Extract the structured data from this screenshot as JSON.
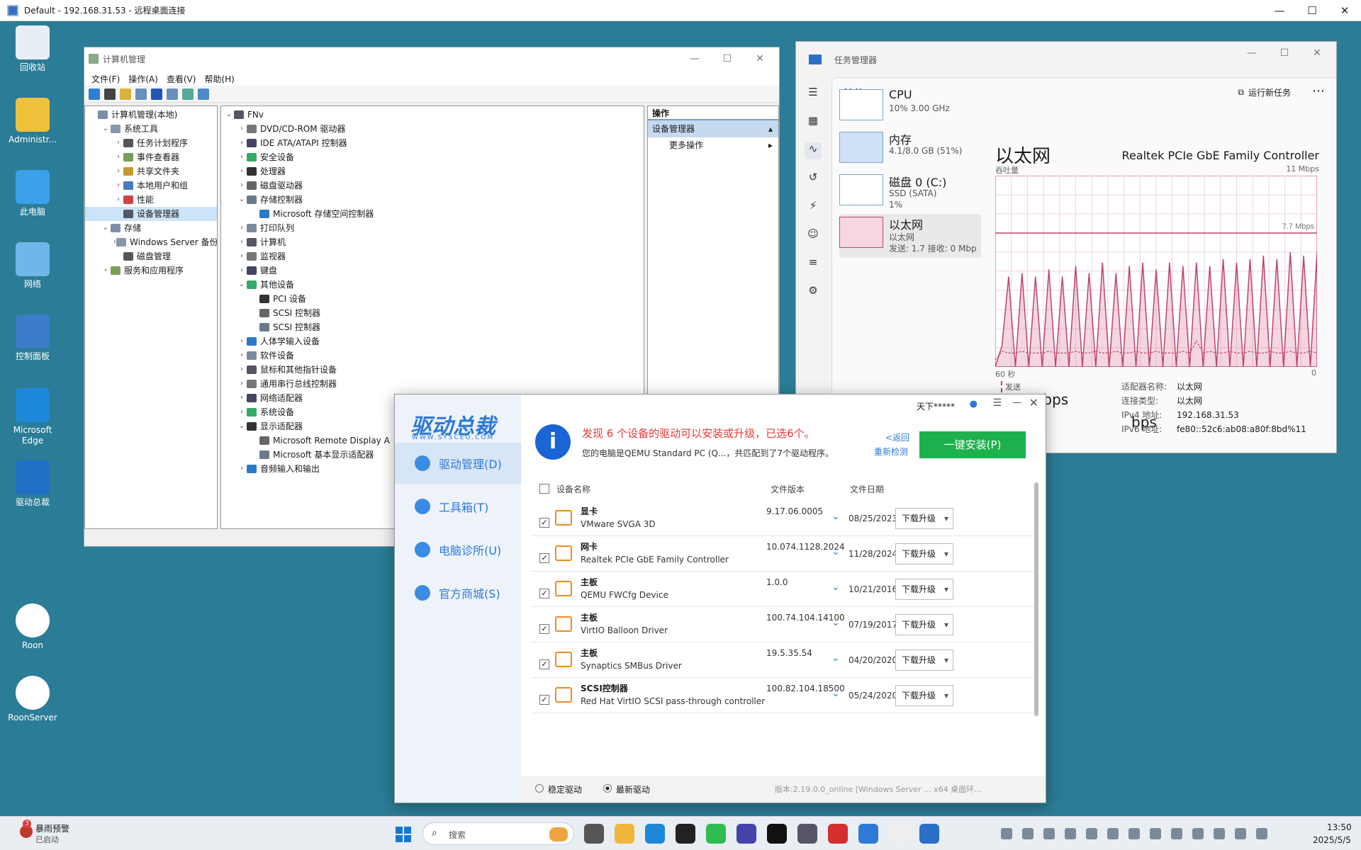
{
  "rdp": {
    "title": "Default - 192.168.31.53 - 远程桌面连接"
  },
  "desktop": {
    "icons": [
      {
        "label": "回收站",
        "icon": "recycle-bin-icon"
      },
      {
        "label": "Administr...",
        "icon": "folder-icon"
      },
      {
        "label": "此电脑",
        "icon": "monitor-icon"
      },
      {
        "label": "网络",
        "icon": "network-icon"
      },
      {
        "label": "控制面板",
        "icon": "control-panel-icon"
      },
      {
        "label": "Microsoft Edge",
        "icon": "edge-icon"
      },
      {
        "label": "驱动总裁",
        "icon": "driver-app-icon"
      },
      {
        "label": "Roon",
        "icon": "roon-icon"
      },
      {
        "label": "RoonServer",
        "icon": "roon-server-icon"
      }
    ]
  },
  "cm": {
    "title": "计算机管理",
    "menu": [
      "文件(F)",
      "操作(A)",
      "查看(V)",
      "帮助(H)"
    ],
    "tree": [
      {
        "label": "计算机管理(本地)",
        "indent": 0,
        "exp": ""
      },
      {
        "label": "系统工具",
        "indent": 1,
        "exp": "⌄"
      },
      {
        "label": "任务计划程序",
        "indent": 2,
        "exp": "›"
      },
      {
        "label": "事件查看器",
        "indent": 2,
        "exp": "›"
      },
      {
        "label": "共享文件夹",
        "indent": 2,
        "exp": "›"
      },
      {
        "label": "本地用户和组",
        "indent": 2,
        "exp": "›"
      },
      {
        "label": "性能",
        "indent": 2,
        "exp": "›"
      },
      {
        "label": "设备管理器",
        "indent": 2,
        "exp": "",
        "sel": true
      },
      {
        "label": "存储",
        "indent": 1,
        "exp": "⌄"
      },
      {
        "label": "Windows Server 备份",
        "indent": 2,
        "exp": "›"
      },
      {
        "label": "磁盘管理",
        "indent": 2,
        "exp": ""
      },
      {
        "label": "服务和应用程序",
        "indent": 1,
        "exp": "›"
      }
    ],
    "devices": [
      {
        "label": "FNv",
        "indent": 0,
        "exp": "⌄"
      },
      {
        "label": "DVD/CD-ROM 驱动器",
        "indent": 1,
        "exp": "›"
      },
      {
        "label": "IDE ATA/ATAPI 控制器",
        "indent": 1,
        "exp": "›"
      },
      {
        "label": "安全设备",
        "indent": 1,
        "exp": "›"
      },
      {
        "label": "处理器",
        "indent": 1,
        "exp": "›"
      },
      {
        "label": "磁盘驱动器",
        "indent": 1,
        "exp": "›"
      },
      {
        "label": "存储控制器",
        "indent": 1,
        "exp": "⌄"
      },
      {
        "label": "Microsoft 存储空间控制器",
        "indent": 2,
        "exp": ""
      },
      {
        "label": "打印队列",
        "indent": 1,
        "exp": "›"
      },
      {
        "label": "计算机",
        "indent": 1,
        "exp": "›"
      },
      {
        "label": "监视器",
        "indent": 1,
        "exp": "›"
      },
      {
        "label": "键盘",
        "indent": 1,
        "exp": "›"
      },
      {
        "label": "其他设备",
        "indent": 1,
        "exp": "⌄"
      },
      {
        "label": "PCI 设备",
        "indent": 2,
        "exp": ""
      },
      {
        "label": "SCSI 控制器",
        "indent": 2,
        "exp": ""
      },
      {
        "label": "SCSI 控制器",
        "indent": 2,
        "exp": ""
      },
      {
        "label": "人体学输入设备",
        "indent": 1,
        "exp": "›"
      },
      {
        "label": "软件设备",
        "indent": 1,
        "exp": "›"
      },
      {
        "label": "鼠标和其他指针设备",
        "indent": 1,
        "exp": "›"
      },
      {
        "label": "通用串行总线控制器",
        "indent": 1,
        "exp": "›"
      },
      {
        "label": "网络适配器",
        "indent": 1,
        "exp": "›"
      },
      {
        "label": "系统设备",
        "indent": 1,
        "exp": "›"
      },
      {
        "label": "显示适配器",
        "indent": 1,
        "exp": "⌄"
      },
      {
        "label": "Microsoft Remote Display A",
        "indent": 2,
        "exp": ""
      },
      {
        "label": "Microsoft 基本显示适配器",
        "indent": 2,
        "exp": ""
      },
      {
        "label": "音频输入和输出",
        "indent": 1,
        "exp": "›"
      }
    ],
    "actions": {
      "header": "操作",
      "section": "设备管理器",
      "more": "更多操作"
    }
  },
  "tm": {
    "title": "任务管理器",
    "page": "性能",
    "run_new": "运行新任务",
    "items": [
      {
        "name": "CPU",
        "s1": "10% 3.00 GHz",
        "s2": ""
      },
      {
        "name": "内存",
        "s1": "4.1/8.0 GB (51%)",
        "s2": ""
      },
      {
        "name": "磁盘 0 (C:)",
        "s1": "SSD (SATA)",
        "s2": "1%"
      },
      {
        "name": "以太网",
        "s1": "以太网",
        "s2": "发送: 1.7  接收: 0 Mbp"
      }
    ],
    "detail": {
      "title": "以太网",
      "adapter": "Realtek PCIe GbE Family Controller",
      "throughput": "吞吐量",
      "max": "11 Mbps",
      "line": "7.7 Mbps",
      "xleft": "60 秒",
      "xright": "0",
      "send_label": "发送",
      "send_value": "1.7 Mbps",
      "recv_value": "bps",
      "info": [
        {
          "k": "适配器名称:",
          "v": "以太网"
        },
        {
          "k": "连接类型:",
          "v": "以太网"
        },
        {
          "k": "IPv4 地址:",
          "v": "192.168.31.53"
        },
        {
          "k": "IPv6 地址:",
          "v": "fe80::52c6:ab08:a80f:8bd%11"
        }
      ]
    }
  },
  "dr": {
    "brand": "驱动总裁",
    "brand_sub": "WWW.SYSCEO.COM",
    "user": "天下*****",
    "nav": [
      "驱动管理(D)",
      "工具箱(T)",
      "电脑诊所(U)",
      "官方商城(S)"
    ],
    "alert": "发现 6 个设备的驱动可以安装或升级，已选6个。",
    "sub": "您的电脑是QEMU Standard PC (Q...，共匹配到了7个驱动程序。",
    "back": "<返回",
    "recheck": "重新检测",
    "install": "一键安装(P)",
    "cols": {
      "name": "设备名称",
      "ver": "文件版本",
      "date": "文件日期"
    },
    "upgrade": "下载升级",
    "rows": [
      {
        "cat": "显卡",
        "name": "VMware SVGA 3D",
        "ver": "9.17.06.0005",
        "date": "08/25/2023"
      },
      {
        "cat": "网卡",
        "name": "Realtek PCIe GbE Family Controller",
        "ver": "10.074.1128.2024",
        "date": "11/28/2024"
      },
      {
        "cat": "主板",
        "name": "QEMU FWCfg Device",
        "ver": "1.0.0",
        "date": "10/21/2016"
      },
      {
        "cat": "主板",
        "name": "VirtIO Balloon Driver",
        "ver": "100.74.104.14100",
        "date": "07/19/2017"
      },
      {
        "cat": "主板",
        "name": "Synaptics SMBus Driver",
        "ver": "19.5.35.54",
        "date": "04/20/2020"
      },
      {
        "cat": "SCSI控制器",
        "name": "Red Hat VirtIO SCSI pass-through controller",
        "ver": "100.82.104.18500",
        "date": "05/24/2020"
      }
    ],
    "stable": "稳定驱动",
    "latest": "最新驱动",
    "version": "版本:2.19.0.0_online [Windows Server ... x64 桌面环..."
  },
  "taskbar": {
    "weather_title": "暴雨预警",
    "weather_sub": "已启动",
    "weather_badge": "3",
    "search": "搜索",
    "time": "13:50",
    "date": "2025/5/5"
  },
  "chart_data": {
    "type": "area",
    "title": "以太网",
    "ylabel": "吞吐量",
    "ylim": [
      0,
      11
    ],
    "x_range_seconds": [
      60,
      0
    ],
    "reference_line": 7.7,
    "series": [
      {
        "name": "发送",
        "values": [
          0,
          1.2,
          5.2,
          0,
          5.4,
          0,
          5.2,
          0,
          5.6,
          0,
          5.2,
          0,
          5.8,
          0,
          5.4,
          0,
          6.0,
          0,
          5.4,
          0,
          5.8,
          0,
          6.0,
          0,
          5.6,
          0,
          6.0,
          0,
          5.8,
          0,
          6.0,
          0,
          5.8,
          0,
          6.2,
          0,
          6.0,
          0,
          6.2,
          0,
          6.4,
          0,
          6.2,
          0,
          6.6,
          0,
          6.4,
          0,
          6.6
        ]
      },
      {
        "name": "接收",
        "values": [
          0.4,
          0.9,
          0.8,
          0.8,
          0.9,
          0.8,
          0.8,
          0.8,
          0.9,
          0.8,
          0.8,
          0.8,
          0.9,
          0.8,
          0.8,
          0.9,
          0.8,
          0.8,
          0.9,
          0.8,
          0.8,
          0.9,
          0.8,
          0.8,
          0.9,
          0.8,
          0.8,
          0.8,
          0.9,
          0.8,
          1.5,
          0.8,
          0.9,
          0.8,
          0.8,
          0.9,
          0.8,
          0.8,
          0.9,
          0.8,
          0.8,
          0.9,
          0.8,
          0.8,
          0.9,
          0.8,
          0.8,
          0.9,
          0.8
        ]
      }
    ]
  }
}
